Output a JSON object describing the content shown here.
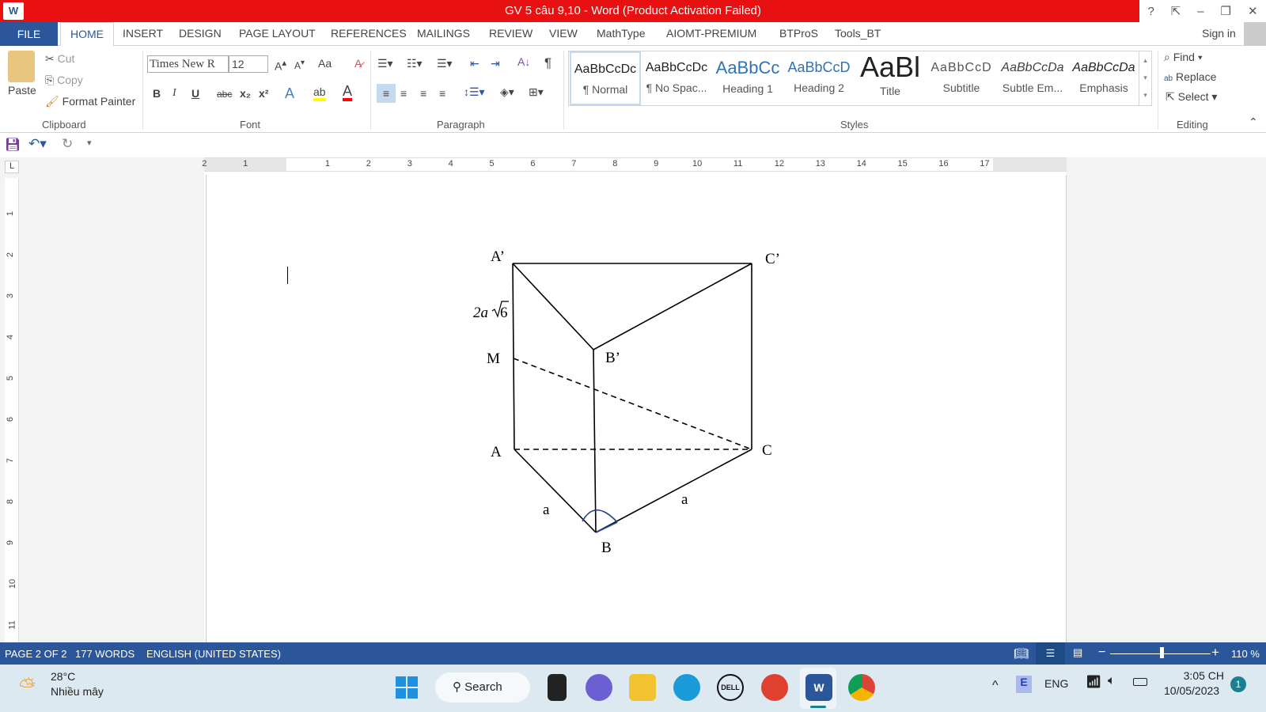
{
  "window": {
    "title": "GV 5 câu 9,10 -  Word (Product Activation Failed)",
    "controls": [
      "?",
      "⇱",
      "–",
      "❐",
      "✕"
    ],
    "app_icon": "W"
  },
  "tabs": {
    "file": "FILE",
    "items": [
      "HOME",
      "INSERT",
      "DESIGN",
      "PAGE LAYOUT",
      "REFERENCES",
      "MAILINGS",
      "REVIEW",
      "VIEW",
      "MathType",
      "AIOMT-PREMIUM",
      "BTProS",
      "Tools_BT"
    ],
    "active": "HOME",
    "sign_in": "Sign in"
  },
  "clipboard": {
    "paste": "Paste",
    "cut": "Cut",
    "copy": "Copy",
    "format_painter": "Format Painter",
    "label": "Clipboard"
  },
  "font": {
    "name": "Times New R",
    "size": "12",
    "label": "Font",
    "case": "Aa",
    "bold": "B",
    "italic": "I",
    "underline": "U",
    "strike": "abc",
    "sub": "x₂",
    "sup": "x²",
    "highlight_color": "#ffff00",
    "font_color": "#ff0000"
  },
  "paragraph": {
    "label": "Paragraph"
  },
  "styles": {
    "label": "Styles",
    "items": [
      {
        "preview": "AaBbCcDc",
        "name": "¶ Normal"
      },
      {
        "preview": "AaBbCcDc",
        "name": "¶ No Spac..."
      },
      {
        "preview": "AaBbCc",
        "name": "Heading 1"
      },
      {
        "preview": "AaBbCcD",
        "name": "Heading 2"
      },
      {
        "preview": "AaBl",
        "name": "Title"
      },
      {
        "preview": "AaBbCcD",
        "name": "Subtitle"
      },
      {
        "preview": "AaBbCcDa",
        "name": "Subtle Em..."
      },
      {
        "preview": "AaBbCcDa",
        "name": "Emphasis"
      }
    ],
    "selected": "¶ Normal"
  },
  "editing": {
    "find": "Find",
    "replace": "Replace",
    "select": "Select",
    "label": "Editing"
  },
  "ruler": {
    "h_left": [
      "2",
      "1"
    ],
    "h_numbers": [
      "1",
      "2",
      "3",
      "4",
      "5",
      "6",
      "7",
      "8",
      "9",
      "10",
      "11",
      "12",
      "13",
      "14",
      "15",
      "16",
      "17"
    ],
    "v_numbers": [
      "1",
      "2",
      "3",
      "4",
      "5",
      "6",
      "7",
      "8",
      "9",
      "10",
      "11"
    ],
    "tab_selector": "L"
  },
  "figure": {
    "labels": {
      "A1": "A’",
      "C1": "C’",
      "B1": "B’",
      "M": "M",
      "A": "A",
      "C": "C",
      "B": "B",
      "AB": "a",
      "BC": "a",
      "height_coef": "2a",
      "height_root": "6"
    }
  },
  "status": {
    "page": "PAGE 2 OF 2",
    "words": "177 WORDS",
    "language": "ENGLISH (UNITED STATES)",
    "zoom": "110 %",
    "zoom_level_percent": 110
  },
  "taskbar": {
    "temp": "28°C",
    "weather": "Nhiều mây",
    "search": "Search",
    "lang": "ENG",
    "time": "3:05 CH",
    "date": "10/05/2023",
    "notifications": "1"
  }
}
